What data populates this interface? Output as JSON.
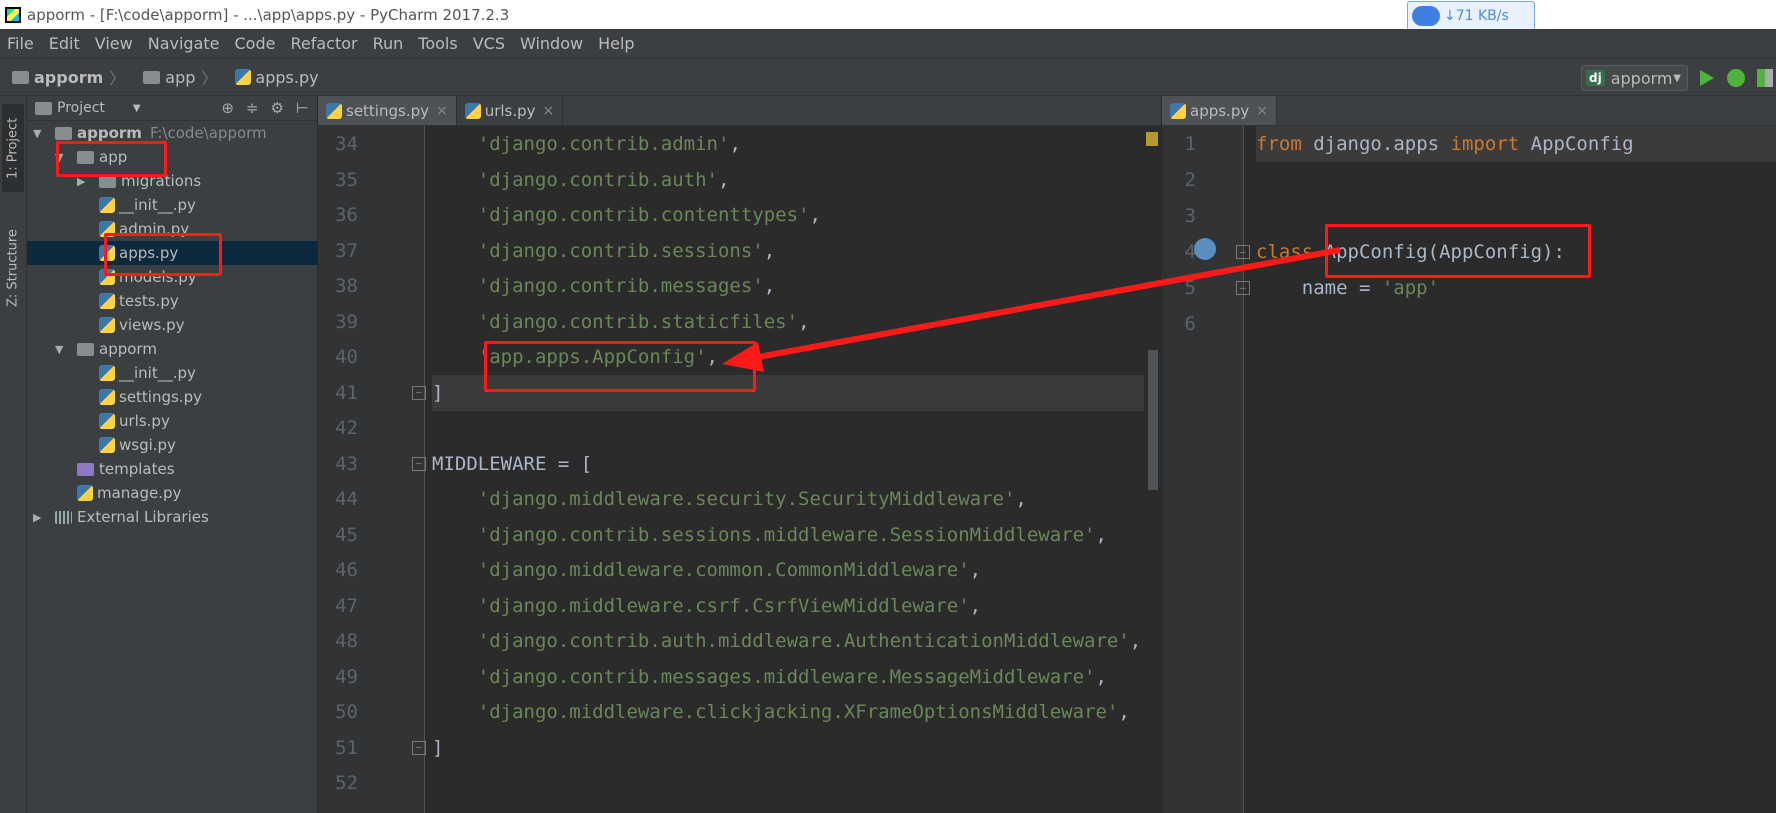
{
  "window": {
    "title": "apporm - [F:\\code\\apporm] - ...\\app\\apps.py - PyCharm 2017.2.3",
    "net_speed": "↓71 KB/s"
  },
  "menu": [
    "File",
    "Edit",
    "View",
    "Navigate",
    "Code",
    "Refactor",
    "Run",
    "Tools",
    "VCS",
    "Window",
    "Help"
  ],
  "breadcrumb": [
    "apporm",
    "app",
    "apps.py"
  ],
  "run_config": {
    "badge": "dj",
    "name": "apporm"
  },
  "tool_tabs": {
    "project": "1: Project",
    "structure": "Z: Structure"
  },
  "project_panel": {
    "title": "Project",
    "tree": [
      {
        "label": "apporm",
        "suffix": "F:\\code\\apporm",
        "icon": "folder-icon",
        "depth": 0,
        "expanded": true
      },
      {
        "label": "app",
        "icon": "folder-icon",
        "depth": 1,
        "expanded": true
      },
      {
        "label": "migrations",
        "icon": "folder-icon",
        "depth": 2,
        "expanded": false
      },
      {
        "label": "__init__.py",
        "icon": "python-file-icon",
        "depth": 2
      },
      {
        "label": "admin.py",
        "icon": "python-file-icon",
        "depth": 2
      },
      {
        "label": "apps.py",
        "icon": "python-file-icon",
        "depth": 2,
        "selected": true
      },
      {
        "label": "models.py",
        "icon": "python-file-icon",
        "depth": 2
      },
      {
        "label": "tests.py",
        "icon": "python-file-icon",
        "depth": 2
      },
      {
        "label": "views.py",
        "icon": "python-file-icon",
        "depth": 2
      },
      {
        "label": "apporm",
        "icon": "folder-icon",
        "depth": 1,
        "expanded": true
      },
      {
        "label": "__init__.py",
        "icon": "python-file-icon",
        "depth": 2
      },
      {
        "label": "settings.py",
        "icon": "python-file-icon",
        "depth": 2
      },
      {
        "label": "urls.py",
        "icon": "python-file-icon",
        "depth": 2
      },
      {
        "label": "wsgi.py",
        "icon": "python-file-icon",
        "depth": 2
      },
      {
        "label": "templates",
        "icon": "purple-folder-icon",
        "depth": 1
      },
      {
        "label": "manage.py",
        "icon": "python-file-icon",
        "depth": 1
      },
      {
        "label": "External Libraries",
        "icon": "library-icon",
        "depth": 0,
        "expanded": false
      }
    ]
  },
  "left_tabs": [
    "settings.py",
    "urls.py"
  ],
  "right_tabs": [
    "apps.py"
  ],
  "left_editor": {
    "lines": [
      {
        "no": "34",
        "text": "    'django.contrib.admin',"
      },
      {
        "no": "35",
        "text": "    'django.contrib.auth',"
      },
      {
        "no": "36",
        "text": "    'django.contrib.contenttypes',"
      },
      {
        "no": "37",
        "text": "    'django.contrib.sessions',"
      },
      {
        "no": "38",
        "text": "    'django.contrib.messages',"
      },
      {
        "no": "39",
        "text": "    'django.contrib.staticfiles',"
      },
      {
        "no": "40",
        "text": "    'app.apps.AppConfig',"
      },
      {
        "no": "41",
        "text": "]"
      },
      {
        "no": "42",
        "text": ""
      },
      {
        "no": "43",
        "text": "MIDDLEWARE = ["
      },
      {
        "no": "44",
        "text": "    'django.middleware.security.SecurityMiddleware',"
      },
      {
        "no": "45",
        "text": "    'django.contrib.sessions.middleware.SessionMiddleware',"
      },
      {
        "no": "46",
        "text": "    'django.middleware.common.CommonMiddleware',"
      },
      {
        "no": "47",
        "text": "    'django.middleware.csrf.CsrfViewMiddleware',"
      },
      {
        "no": "48",
        "text": "    'django.contrib.auth.middleware.AuthenticationMiddleware',"
      },
      {
        "no": "49",
        "text": "    'django.contrib.messages.middleware.MessageMiddleware',"
      },
      {
        "no": "50",
        "text": "    'django.middleware.clickjacking.XFrameOptionsMiddleware',"
      },
      {
        "no": "51",
        "text": "]"
      },
      {
        "no": "52",
        "text": ""
      }
    ]
  },
  "right_editor": {
    "lines": [
      {
        "no": "1",
        "text": "from django.apps import AppConfig"
      },
      {
        "no": "2",
        "text": ""
      },
      {
        "no": "3",
        "text": ""
      },
      {
        "no": "4",
        "text": "class AppConfig(AppConfig):"
      },
      {
        "no": "5",
        "text": "    name = 'app'"
      },
      {
        "no": "6",
        "text": ""
      }
    ]
  },
  "colors": {
    "string": "#6a8759",
    "keyword": "#cc7832",
    "plain": "#a9b7c6",
    "annotation": "#ff1a1a",
    "selection": "#0d293e"
  }
}
